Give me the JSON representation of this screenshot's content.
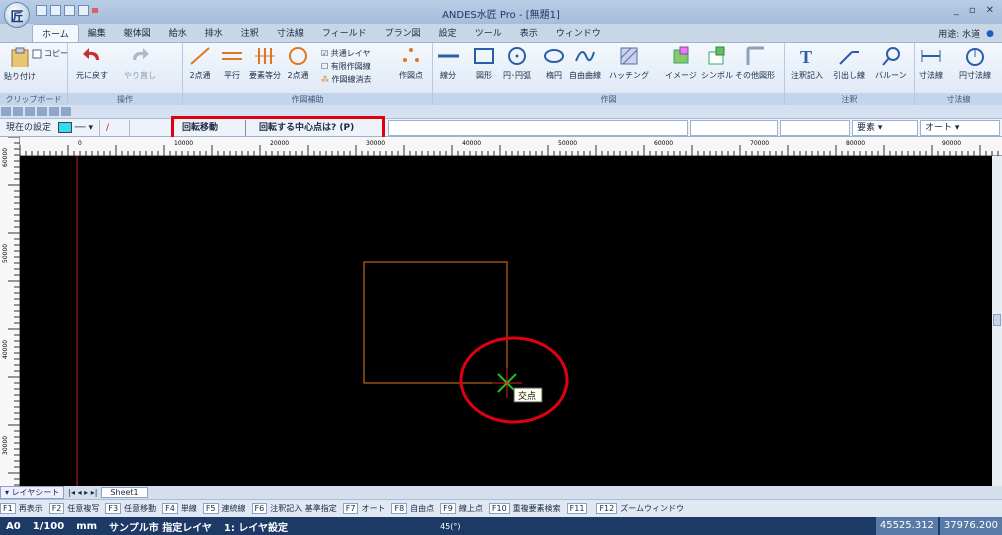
{
  "window": {
    "title": "ANDES水匠 Pro - [無題1]",
    "app_icon_label": "匠"
  },
  "tabs": [
    "ホーム",
    "編集",
    "躯体図",
    "給水",
    "排水",
    "注釈",
    "寸法線",
    "フィールド",
    "プラン図",
    "設定",
    "ツール",
    "表示",
    "ウィンドウ"
  ],
  "usage": {
    "label": "用途: 水道"
  },
  "ribbon": {
    "clipboard": {
      "copy": "コピー",
      "paste": "貼り付け",
      "group": "クリップボード"
    },
    "operation": {
      "undo": "元に戻す",
      "redo": "やり直し",
      "group": "操作"
    },
    "assist": {
      "two_point": "2点通",
      "parallel": "平行",
      "equal": "要素等分",
      "circle_two": "2点通",
      "common_layer": "共通レイヤ",
      "limited_line": "有限作図線",
      "erase_line": "作図線消去",
      "group": "作図補助"
    },
    "draw": {
      "point": "作図点",
      "line": "線分",
      "shape": "図形",
      "circle": "円･円弧",
      "ellipse": "楕円",
      "curve": "自由曲線",
      "hatch": "ハッチング",
      "image": "イメージ",
      "symbol": "シンボル",
      "other": "その他図形",
      "group": "作図"
    },
    "annotation": {
      "text": "注釈記入",
      "leader": "引出し線",
      "balloon": "バルーン",
      "group": "注釈"
    },
    "dimension": {
      "dim": "寸法線",
      "circle_dim": "円寸法線",
      "group": "寸法線"
    }
  },
  "statusline": {
    "current_setting": "現在の設定",
    "command": "回転移動",
    "prompt": "回転する中心点は? (P)",
    "element": "要素",
    "auto": "オート"
  },
  "ruler_h": [
    "0",
    "10000",
    "20000",
    "30000",
    "40000",
    "50000",
    "60000",
    "70000",
    "80000",
    "90000"
  ],
  "ruler_v": [
    "60000",
    "50000",
    "40000",
    "30000"
  ],
  "canvas": {
    "tooltip": "交点"
  },
  "sheet": {
    "layer_sheet": "レイヤシート",
    "sheet1": "Sheet1"
  },
  "fkeys": [
    {
      "key": "F1",
      "label": "再表示"
    },
    {
      "key": "F2",
      "label": "任意複写"
    },
    {
      "key": "F3",
      "label": "任意移動"
    },
    {
      "key": "F4",
      "label": "単線"
    },
    {
      "key": "F5",
      "label": "連続線"
    },
    {
      "key": "F6",
      "label": "注釈記入 基準指定"
    },
    {
      "key": "F7",
      "label": "オート"
    },
    {
      "key": "F8",
      "label": "自由点"
    },
    {
      "key": "F9",
      "label": "線上点"
    },
    {
      "key": "F10",
      "label": "重複要素検索"
    },
    {
      "key": "F11",
      "label": ""
    },
    {
      "key": "F12",
      "label": "ズームウィンドウ"
    }
  ],
  "infobar": {
    "paper": "A0",
    "scale": "1/100",
    "unit": "mm",
    "city": "サンプル市 指定レイヤ",
    "layer": "1: レイヤ設定",
    "angle": "45(°)"
  },
  "coords": {
    "x": "45525.312",
    "y": "37976.200"
  },
  "colors": {
    "accent_red": "#e00010",
    "canvas_bg": "#000000",
    "square_stroke": "#e07820",
    "cursor": "#20c020",
    "swatch": "#31dcf2"
  }
}
